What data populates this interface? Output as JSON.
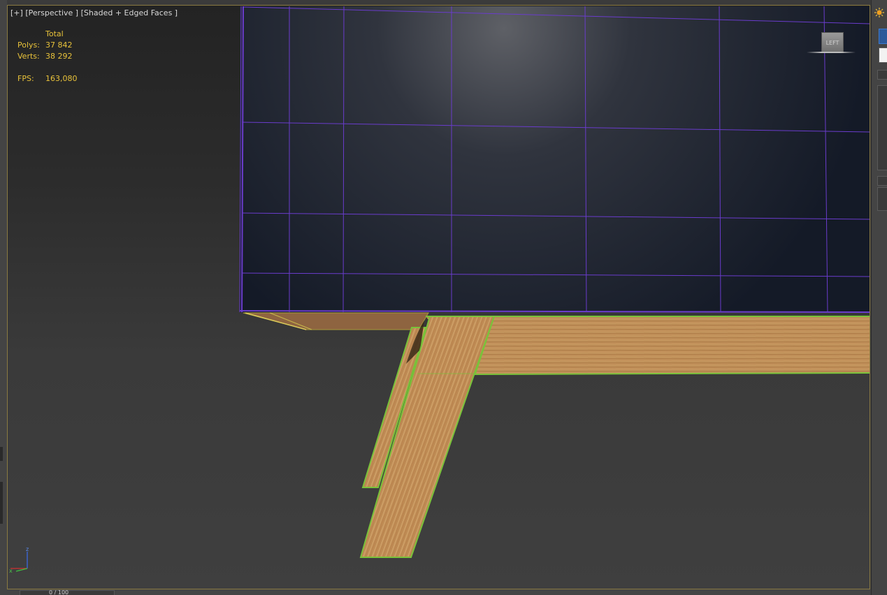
{
  "viewport": {
    "label_plus": "[+]",
    "label_view": "[Perspective ]",
    "label_shading": "[Shaded + Edged Faces ]"
  },
  "stats": {
    "header": "Total",
    "polys_label": "Polys:",
    "polys_value": "37 842",
    "verts_label": "Verts:",
    "verts_value": "38 292",
    "fps_label": "FPS:",
    "fps_value": "163,080"
  },
  "viewcube": {
    "face_label": "LEFT"
  },
  "axes": {
    "z_label": "z",
    "x_label": "x"
  },
  "timeline": {
    "frame_text": "0 / 100"
  },
  "colors": {
    "viewport_border": "#8a7a42",
    "stats_text": "#e8c23a",
    "cabinet_wire": "#6a3ccc",
    "selection_outline": "#7ac23a",
    "wood": "#c08a52",
    "cabinet_panel": "#141a27"
  },
  "icons": {
    "right_panel_top": "sun-light-icon",
    "right_panel_radio": "radio-icon",
    "axis": "axis-tripod-icon"
  }
}
